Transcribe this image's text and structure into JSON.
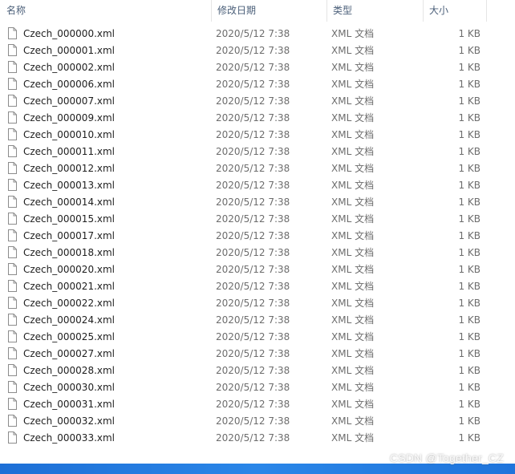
{
  "header": {
    "name": "名称",
    "date": "修改日期",
    "type": "类型",
    "size": "大小",
    "sort_glyph": "^"
  },
  "files": [
    {
      "name": "Czech_000000.xml",
      "date": "2020/5/12 7:38",
      "type": "XML 文档",
      "size": "1 KB"
    },
    {
      "name": "Czech_000001.xml",
      "date": "2020/5/12 7:38",
      "type": "XML 文档",
      "size": "1 KB"
    },
    {
      "name": "Czech_000002.xml",
      "date": "2020/5/12 7:38",
      "type": "XML 文档",
      "size": "1 KB"
    },
    {
      "name": "Czech_000006.xml",
      "date": "2020/5/12 7:38",
      "type": "XML 文档",
      "size": "1 KB"
    },
    {
      "name": "Czech_000007.xml",
      "date": "2020/5/12 7:38",
      "type": "XML 文档",
      "size": "1 KB"
    },
    {
      "name": "Czech_000009.xml",
      "date": "2020/5/12 7:38",
      "type": "XML 文档",
      "size": "1 KB"
    },
    {
      "name": "Czech_000010.xml",
      "date": "2020/5/12 7:38",
      "type": "XML 文档",
      "size": "1 KB"
    },
    {
      "name": "Czech_000011.xml",
      "date": "2020/5/12 7:38",
      "type": "XML 文档",
      "size": "1 KB"
    },
    {
      "name": "Czech_000012.xml",
      "date": "2020/5/12 7:38",
      "type": "XML 文档",
      "size": "1 KB"
    },
    {
      "name": "Czech_000013.xml",
      "date": "2020/5/12 7:38",
      "type": "XML 文档",
      "size": "1 KB"
    },
    {
      "name": "Czech_000014.xml",
      "date": "2020/5/12 7:38",
      "type": "XML 文档",
      "size": "1 KB"
    },
    {
      "name": "Czech_000015.xml",
      "date": "2020/5/12 7:38",
      "type": "XML 文档",
      "size": "1 KB"
    },
    {
      "name": "Czech_000017.xml",
      "date": "2020/5/12 7:38",
      "type": "XML 文档",
      "size": "1 KB"
    },
    {
      "name": "Czech_000018.xml",
      "date": "2020/5/12 7:38",
      "type": "XML 文档",
      "size": "1 KB"
    },
    {
      "name": "Czech_000020.xml",
      "date": "2020/5/12 7:38",
      "type": "XML 文档",
      "size": "1 KB"
    },
    {
      "name": "Czech_000021.xml",
      "date": "2020/5/12 7:38",
      "type": "XML 文档",
      "size": "1 KB"
    },
    {
      "name": "Czech_000022.xml",
      "date": "2020/5/12 7:38",
      "type": "XML 文档",
      "size": "1 KB"
    },
    {
      "name": "Czech_000024.xml",
      "date": "2020/5/12 7:38",
      "type": "XML 文档",
      "size": "1 KB"
    },
    {
      "name": "Czech_000025.xml",
      "date": "2020/5/12 7:38",
      "type": "XML 文档",
      "size": "1 KB"
    },
    {
      "name": "Czech_000027.xml",
      "date": "2020/5/12 7:38",
      "type": "XML 文档",
      "size": "1 KB"
    },
    {
      "name": "Czech_000028.xml",
      "date": "2020/5/12 7:38",
      "type": "XML 文档",
      "size": "1 KB"
    },
    {
      "name": "Czech_000030.xml",
      "date": "2020/5/12 7:38",
      "type": "XML 文档",
      "size": "1 KB"
    },
    {
      "name": "Czech_000031.xml",
      "date": "2020/5/12 7:38",
      "type": "XML 文档",
      "size": "1 KB"
    },
    {
      "name": "Czech_000032.xml",
      "date": "2020/5/12 7:38",
      "type": "XML 文档",
      "size": "1 KB"
    },
    {
      "name": "Czech_000033.xml",
      "date": "2020/5/12 7:38",
      "type": "XML 文档",
      "size": "1 KB"
    }
  ],
  "file_icon": "document-icon",
  "watermark": "CSDN @Together_CZ",
  "colors": {
    "header_text": "#4c607a",
    "secondary_text": "#6d6d6d",
    "taskbar": "#1f74db"
  }
}
